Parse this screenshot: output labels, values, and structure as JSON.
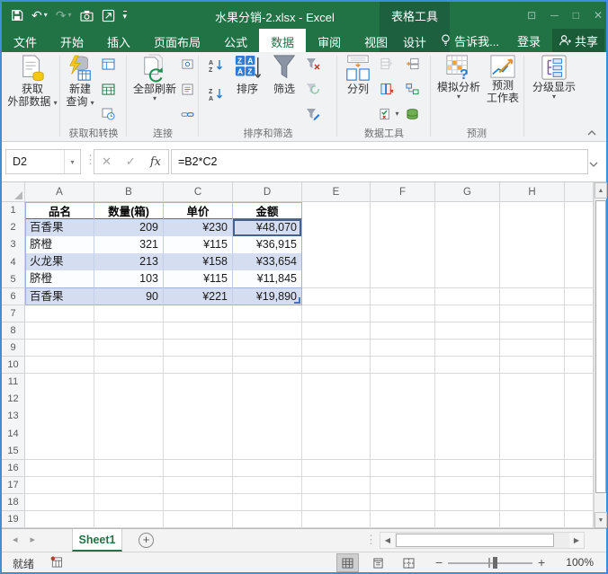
{
  "titlebar": {
    "title": "水果分销-2.xlsx - Excel",
    "context_tool": "表格工具"
  },
  "tabs": {
    "file": "文件",
    "home": "开始",
    "insert": "插入",
    "page_layout": "页面布局",
    "formulas": "公式",
    "data": "数据",
    "review": "审阅",
    "view": "视图",
    "design": "设计",
    "tell_me": "告诉我...",
    "sign_in": "登录",
    "share": "共享"
  },
  "ribbon": {
    "get_external_line1": "获取",
    "get_external_line2": "外部数据",
    "new_query_line1": "新建",
    "new_query_line2": "查询",
    "refresh_all": "全部刷新",
    "sort_label": "排序",
    "filter_label": "筛选",
    "split_label": "分列",
    "what_if_label": "模拟分析",
    "forecast_line1": "预测",
    "forecast_line2": "工作表",
    "outline_label": "分级显示",
    "groups": {
      "get_transform": "获取和转换",
      "connections": "连接",
      "sort_filter": "排序和筛选",
      "data_tools": "数据工具",
      "forecast": "预测"
    }
  },
  "formula_bar": {
    "name_box": "D2",
    "fx": "fx",
    "formula": "=B2*C2"
  },
  "grid": {
    "column_headers": [
      "A",
      "B",
      "C",
      "D",
      "E",
      "F",
      "G",
      "H"
    ],
    "row_count": 19,
    "active_cell": "D2",
    "table": {
      "headers": [
        "品名",
        "数量(箱)",
        "单价",
        "金额"
      ],
      "rows": [
        [
          "百香果",
          "209",
          "¥230",
          "¥48,070"
        ],
        [
          "脐橙",
          "321",
          "¥115",
          "¥36,915"
        ],
        [
          "火龙果",
          "213",
          "¥158",
          "¥33,654"
        ],
        [
          "脐橙",
          "103",
          "¥115",
          "¥11,845"
        ],
        [
          "百香果",
          "90",
          "¥221",
          "¥19,890"
        ]
      ]
    }
  },
  "sheet_bar": {
    "sheet_name": "Sheet1"
  },
  "status_bar": {
    "ready": "就绪",
    "zoom_level": "100%"
  },
  "colors": {
    "accent_green": "#217346",
    "table_border_blue": "#2e75b6",
    "band_fill": "#d5ddf0"
  }
}
